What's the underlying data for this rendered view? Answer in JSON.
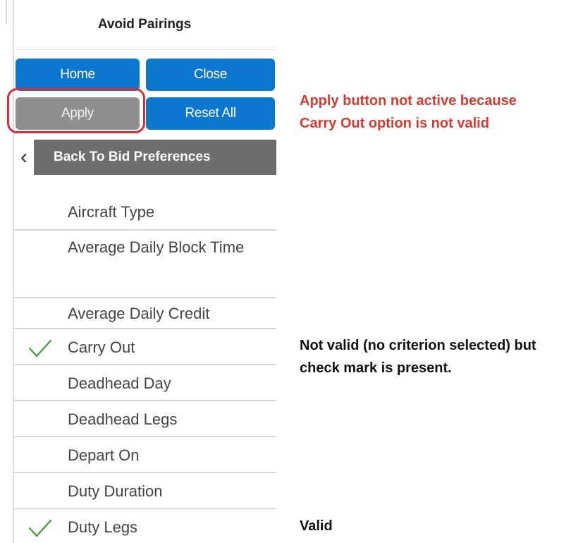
{
  "panel": {
    "title": "Avoid Pairings",
    "buttons": {
      "home": "Home",
      "close": "Close",
      "apply": "Apply",
      "reset_all": "Reset All"
    },
    "back_label": "Back To Bid Preferences",
    "items": [
      {
        "label": "Aircraft Type",
        "checked": false
      },
      {
        "label": "Average Daily Block Time",
        "checked": false
      },
      {
        "label": "Average Daily Credit",
        "checked": false
      },
      {
        "label": "Carry Out",
        "checked": true
      },
      {
        "label": "Deadhead Day",
        "checked": false
      },
      {
        "label": "Deadhead Legs",
        "checked": false
      },
      {
        "label": "Depart On",
        "checked": false
      },
      {
        "label": "Duty Duration",
        "checked": false
      },
      {
        "label": "Duty Legs",
        "checked": true
      }
    ]
  },
  "annotations": {
    "apply_note_line1": "Apply button not active because",
    "apply_note_line2": "Carry Out option is not valid",
    "carry_note_line1": "Not valid (no criterion selected) but",
    "carry_note_line2": "check mark is present.",
    "valid_note": "Valid"
  },
  "colors": {
    "button_blue": "#0b77cf",
    "button_disabled": "#8f8f8f",
    "back_bar": "#6e6e6e",
    "highlight_red": "#d1303a",
    "note_red": "#d63a2f",
    "check_green": "#4a9a4a"
  }
}
